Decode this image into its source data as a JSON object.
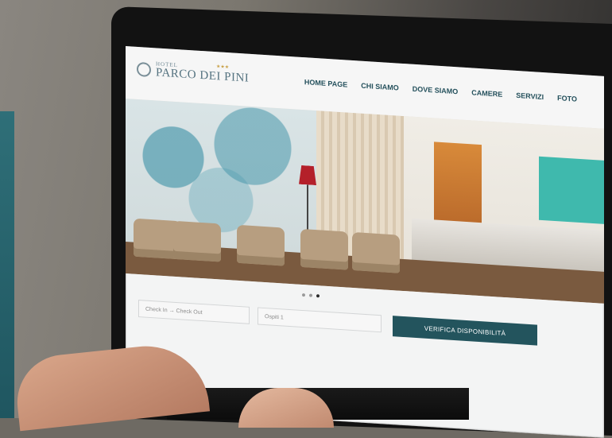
{
  "site": {
    "logo_small": "HOTEL",
    "logo_big": "PARCO DEI PINI",
    "logo_stars": "★★★"
  },
  "nav": {
    "items": [
      "HOME PAGE",
      "CHI SIAMO",
      "DOVE SIAMO",
      "CAMERE",
      "SERVIZI",
      "FOTO"
    ]
  },
  "booking": {
    "dates_placeholder": "Check In → Check Out",
    "guests_placeholder": "Ospiti 1",
    "verify_label": "VERIFICA DISPONIBILITÀ"
  },
  "carousel": {
    "slide_count": 3,
    "active_slide": 3
  },
  "colors": {
    "brand": "#23545d",
    "nav_text": "#24505c"
  }
}
